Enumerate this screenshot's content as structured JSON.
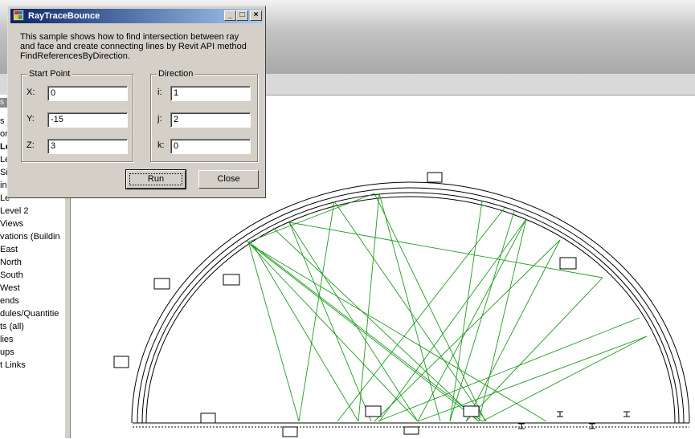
{
  "dialog": {
    "title": "RayTraceBounce",
    "description_lines": [
      "This sample shows how to find intersection between ray",
      "and face and create connecting lines by Revit API method",
      "FindReferencesByDirection."
    ],
    "start_point": {
      "legend": "Start Point",
      "x_label": "X:",
      "x_value": "0",
      "y_label": "Y:",
      "y_value": "-15",
      "z_label": "Z:",
      "z_value": "3"
    },
    "direction": {
      "legend": "Direction",
      "i_label": "i:",
      "i_value": "1",
      "j_label": "j:",
      "j_value": "2",
      "k_label": "k:",
      "k_value": "0"
    },
    "run_label": "Run",
    "close_label": "Close",
    "title_buttons": {
      "minimize": "_",
      "maximize": "□",
      "close": "×"
    }
  },
  "project_browser": {
    "header": "s -",
    "items": [
      {
        "label": "s (",
        "bold": false
      },
      {
        "label": "or",
        "bold": false
      },
      {
        "label": "Le",
        "bold": true
      },
      {
        "label": "Le",
        "bold": false
      },
      {
        "label": "Si",
        "bold": false
      },
      {
        "label": "ing",
        "bold": false
      },
      {
        "label": "Le",
        "bold": false
      },
      {
        "label": "Level 2",
        "bold": false
      },
      {
        "label": "Views",
        "bold": false
      },
      {
        "label": "vations (Buildin",
        "bold": false
      },
      {
        "label": "East",
        "bold": false
      },
      {
        "label": "North",
        "bold": false
      },
      {
        "label": "South",
        "bold": false
      },
      {
        "label": "West",
        "bold": false
      },
      {
        "label": "ends",
        "bold": false
      },
      {
        "label": "dules/Quantitie",
        "bold": false
      },
      {
        "label": "ts (all)",
        "bold": false
      },
      {
        "label": "lies",
        "bold": false
      },
      {
        "label": "ups",
        "bold": false
      },
      {
        "label": "t Links",
        "bold": false
      }
    ]
  },
  "colors": {
    "titlebar_start": "#0a246a",
    "titlebar_end": "#a6caf0",
    "dialog_face": "#d4d0c8",
    "ray_line": "#1f9b1f",
    "wall_line": "#000000"
  }
}
